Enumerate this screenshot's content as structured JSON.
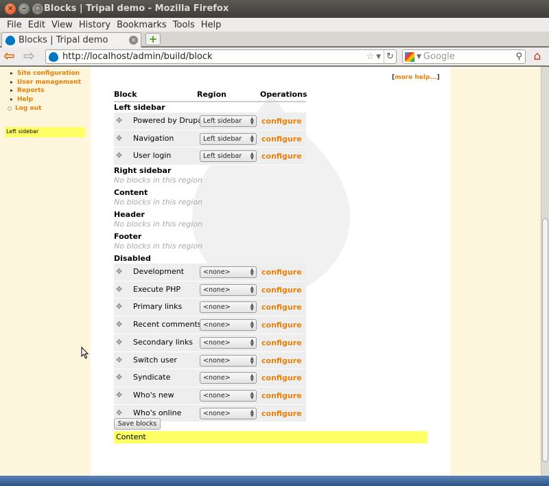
{
  "window": {
    "title": "Blocks | Tripal demo - Mozilla Firefox"
  },
  "menubar": [
    "File",
    "Edit",
    "View",
    "History",
    "Bookmarks",
    "Tools",
    "Help"
  ],
  "tab": {
    "label": "Blocks | Tripal demo"
  },
  "navigation": {
    "url": "http://localhost/admin/build/block",
    "search_placeholder": "Google"
  },
  "sidebar": {
    "submenu": [
      "Site configuration",
      "User management",
      "Reports",
      "Help"
    ],
    "top_items": [
      "Log out"
    ],
    "region_label": "Left sidebar"
  },
  "more_help": "more help...",
  "table": {
    "headers": {
      "block": "Block",
      "region": "Region",
      "operations": "Operations"
    }
  },
  "regions": [
    {
      "title": "Left sidebar",
      "blocks": [
        {
          "name": "Powered by Drupal",
          "region": "Left sidebar",
          "op": "configure"
        },
        {
          "name": "Navigation",
          "region": "Left sidebar",
          "op": "configure"
        },
        {
          "name": "User login",
          "region": "Left sidebar",
          "op": "configure"
        }
      ]
    },
    {
      "title": "Right sidebar",
      "empty": "No blocks in this region"
    },
    {
      "title": "Content",
      "empty": "No blocks in this region"
    },
    {
      "title": "Header",
      "empty": "No blocks in this region"
    },
    {
      "title": "Footer",
      "empty": "No blocks in this region"
    },
    {
      "title": "Disabled",
      "blocks": [
        {
          "name": "Development",
          "region": "<none>",
          "op": "configure"
        },
        {
          "name": "Execute PHP",
          "region": "<none>",
          "op": "configure"
        },
        {
          "name": "Primary links",
          "region": "<none>",
          "op": "configure"
        },
        {
          "name": "Recent comments",
          "region": "<none>",
          "op": "configure"
        },
        {
          "name": "Secondary links",
          "region": "<none>",
          "op": "configure"
        },
        {
          "name": "Switch user",
          "region": "<none>",
          "op": "configure"
        },
        {
          "name": "Syndicate",
          "region": "<none>",
          "op": "configure"
        },
        {
          "name": "Who's new",
          "region": "<none>",
          "op": "configure"
        },
        {
          "name": "Who's online",
          "region": "<none>",
          "op": "configure"
        }
      ]
    }
  ],
  "save_label": "Save blocks",
  "content_region_label": "Content",
  "colors": {
    "link_orange": "#e6800a",
    "region_highlight": "#ffff66",
    "sidebar_bg": "#fdf5dc"
  }
}
